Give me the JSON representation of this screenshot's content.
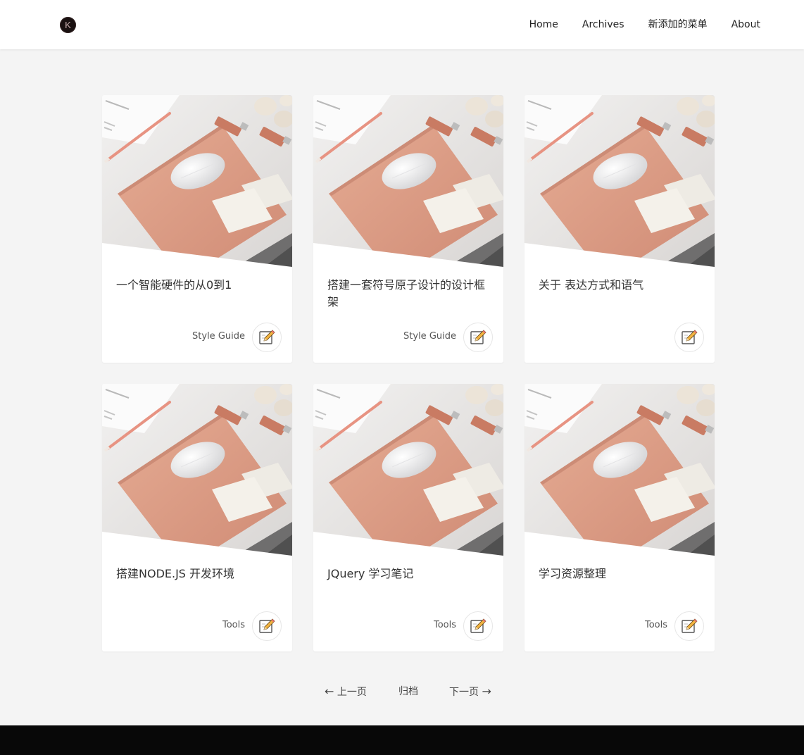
{
  "header": {
    "logo_letter": "K",
    "nav": [
      {
        "label": "Home"
      },
      {
        "label": "Archives"
      },
      {
        "label": "新添加的菜单"
      },
      {
        "label": "About"
      }
    ]
  },
  "posts": [
    {
      "title": "一个智能硬件的从0到1",
      "category": "Style Guide"
    },
    {
      "title": "搭建一套符号原子设计的设计框架",
      "category": "Style Guide"
    },
    {
      "title": "关于 表达方式和语气",
      "category": ""
    },
    {
      "title": "搭建NODE.JS 开发环境",
      "category": "Tools"
    },
    {
      "title": "JQuery 学习笔记",
      "category": "Tools"
    },
    {
      "title": "学习资源整理",
      "category": "Tools"
    }
  ],
  "pagination": {
    "prev_arrow": "←",
    "prev_label": "上一页",
    "archive_label": "归档",
    "next_label": "下一页",
    "next_arrow": "→"
  },
  "colors": {
    "background": "#f4f4f4",
    "card": "#ffffff",
    "footer": "#080808",
    "mousepad": "#dc9a83",
    "pencil": "#e79382"
  },
  "icons": {
    "logo": "k-logo-icon",
    "edit": "edit-note-icon"
  }
}
